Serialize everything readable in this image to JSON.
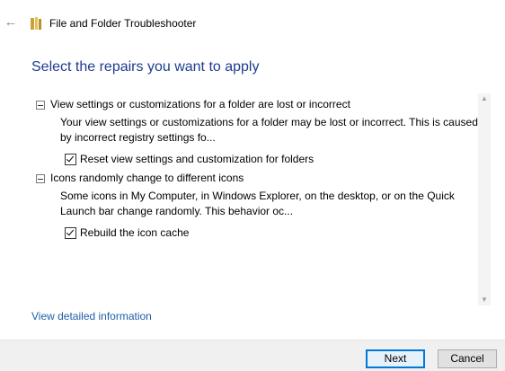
{
  "window": {
    "title": "File and Folder Troubleshooter",
    "back_icon": "←",
    "corner_mark": "'"
  },
  "page": {
    "heading": "Select the repairs you want to apply"
  },
  "repairs": [
    {
      "title": "View settings or customizations for a folder are lost or incorrect",
      "description": "Your view settings or customizations for a folder may be lost or incorrect. This is caused by incorrect registry settings fo...",
      "option_label": "Reset view settings and customization for folders",
      "checked": true
    },
    {
      "title": "Icons randomly change to different icons",
      "description": "Some icons in My Computer, in Windows Explorer, on the desktop, or on the Quick Launch bar change randomly. This behavior oc...",
      "option_label": "Rebuild the icon cache",
      "checked": true
    }
  ],
  "links": {
    "details": "View detailed information"
  },
  "buttons": {
    "next": "Next",
    "cancel": "Cancel"
  },
  "scroll": {
    "up": "▲",
    "down": "▼"
  },
  "colors": {
    "heading": "#1e3d8f",
    "link": "#1e5fa8",
    "primary_border": "#0078d7"
  }
}
